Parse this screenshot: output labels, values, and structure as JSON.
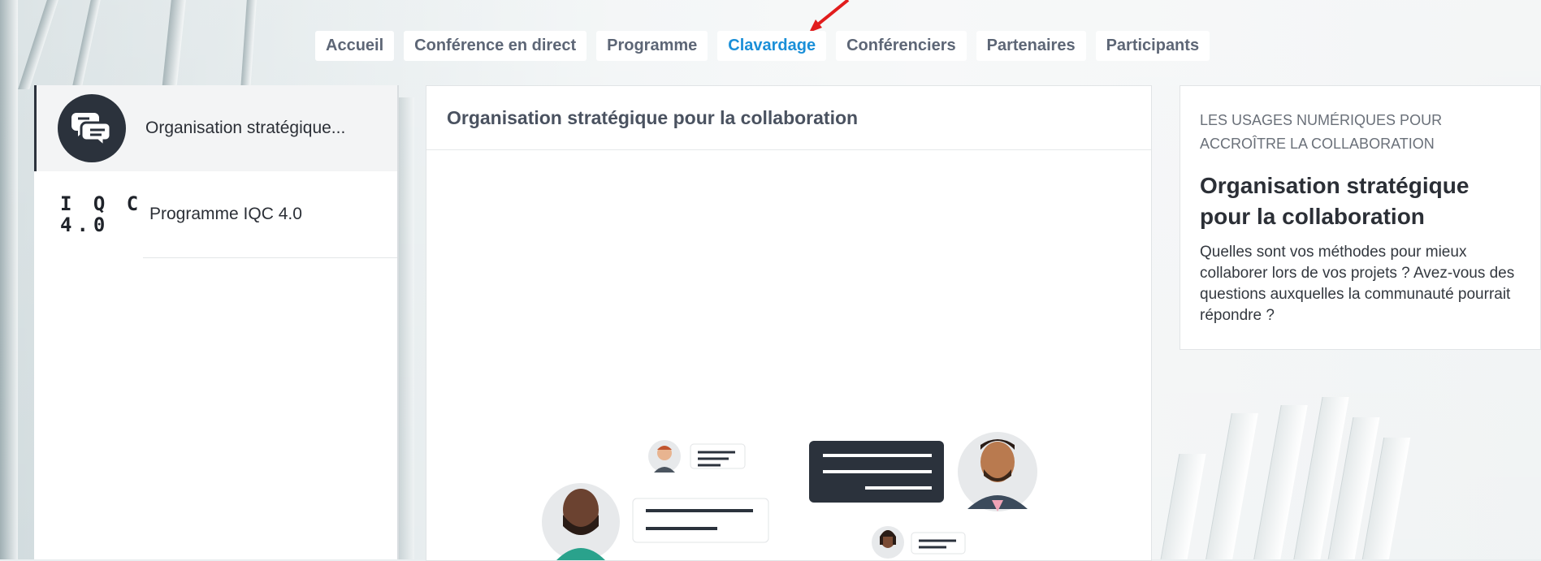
{
  "nav": {
    "tabs": [
      {
        "label": "Accueil"
      },
      {
        "label": "Conférence en direct"
      },
      {
        "label": "Programme"
      },
      {
        "label": "Clavardage"
      },
      {
        "label": "Conférenciers"
      },
      {
        "label": "Partenaires"
      },
      {
        "label": "Participants"
      }
    ],
    "active_index": 3,
    "active_color": "#1a8fd8"
  },
  "rooms": [
    {
      "label": "Organisation stratégique...",
      "icon": "chat-bubbles-icon"
    },
    {
      "label": "Programme IQC 4.0",
      "logo_line1": "I Q C",
      "logo_line2": "4.0"
    }
  ],
  "chat": {
    "header": "Organisation stratégique pour la collaboration"
  },
  "info": {
    "kicker": "LES USAGES NUMÉRIQUES POUR ACCROÎTRE LA COLLABORATION",
    "title": "Organisation stratégique pour la collaboration",
    "description": "Quelles sont vos méthodes pour mieux collaborer lors de vos projets ? Avez-vous des questions auxquelles la communauté pourrait répondre ?"
  },
  "colors": {
    "dark": "#2b323c",
    "annotation_arrow": "#e11d1d"
  }
}
